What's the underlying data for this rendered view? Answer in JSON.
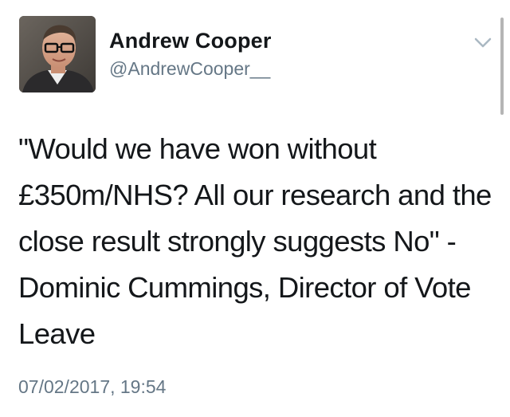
{
  "tweet": {
    "display_name": "Andrew Cooper",
    "handle": "@AndrewCooper__",
    "text": "\"Would we have won without £350m/NHS? All our research and the close result strongly suggests No\" - Dominic Cummings, Director of Vote Leave",
    "timestamp": "07/02/2017, 19:54"
  },
  "icons": {
    "avatar": "profile-photo",
    "menu": "chevron-down-icon"
  },
  "colors": {
    "text": "#14171a",
    "secondary": "#657786",
    "chevron": "#aab8c2"
  }
}
